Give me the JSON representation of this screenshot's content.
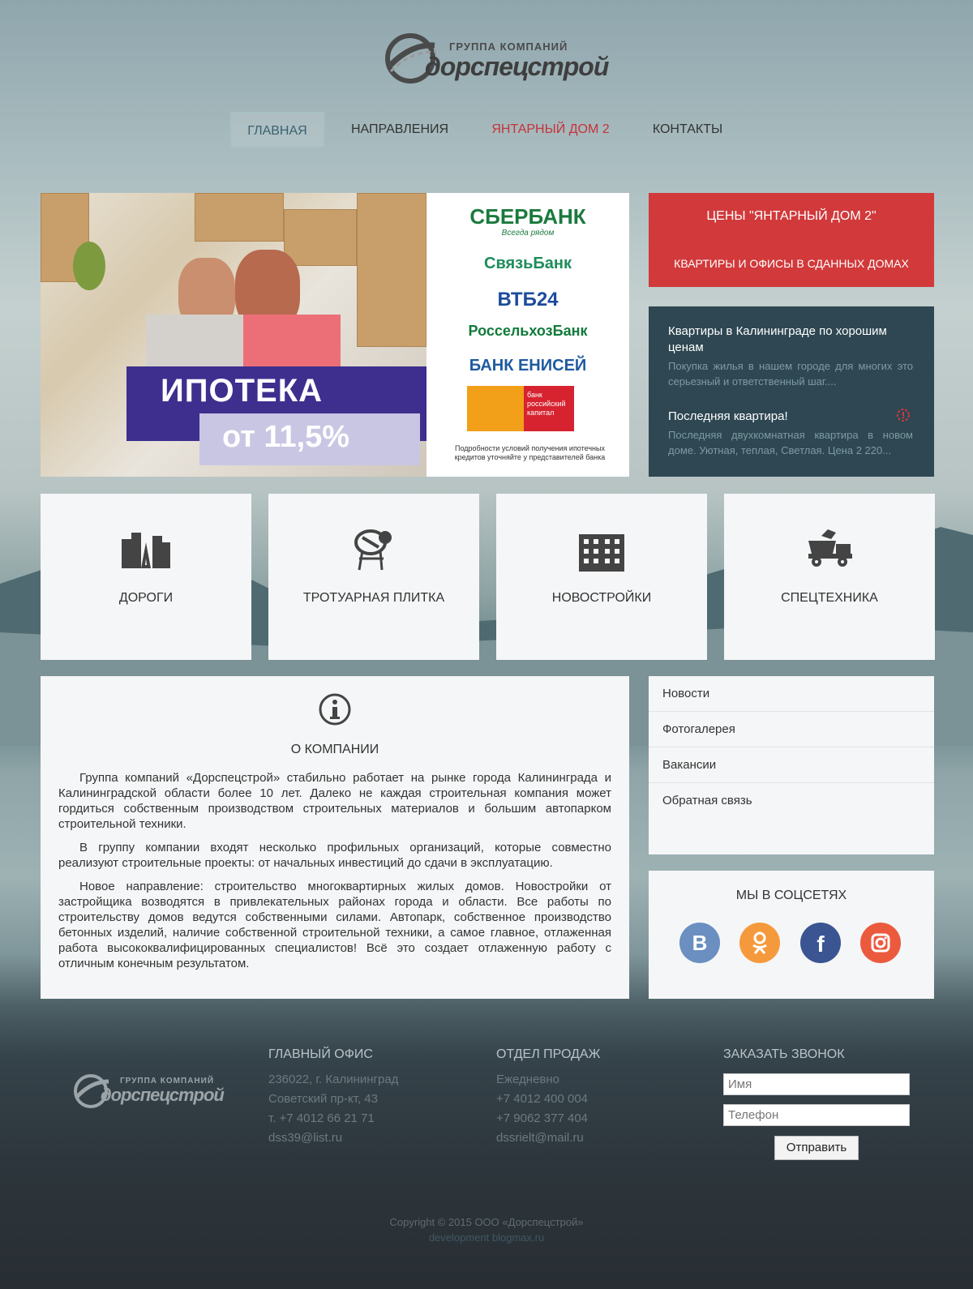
{
  "logo": {
    "tagline": "ГРУППА КОМПАНИЙ",
    "name": "дорспецстрой"
  },
  "nav": {
    "items": [
      "ГЛАВНАЯ",
      "НАПРАВЛЕНИЯ",
      "ЯНТАРНЫЙ ДОМ 2",
      "КОНТАКТЫ"
    ],
    "active": "ГЛАВНАЯ",
    "accent_color": "#c5333a"
  },
  "banner": {
    "title": "ИПОТЕКА",
    "rate": "от 11,5%",
    "banks": [
      "СБЕРБАНК",
      "Всегда рядом",
      "СвязьБанк",
      "ВТБ24",
      "РоссельхозБанк",
      "БАНК ЕНИСЕЙ",
      "банк российский капитал"
    ],
    "note": "Подробности условий получения ипотечных кредитов уточняйте у представителей банка"
  },
  "prices": {
    "title": "ЦЕНЫ \"ЯНТАРНЫЙ ДОМ 2\"",
    "subtitle": "КВАРТИРЫ И ОФИСЫ В СДАННЫХ ДОМАХ",
    "color": "#d1393b"
  },
  "news": [
    {
      "title": "Квартиры в Калининграде по хорошим ценам",
      "text": "Покупка жилья в нашем городе для многих это серьезный и ответственный шаг...."
    },
    {
      "title": "Последняя квартира!",
      "text": "Последняя двухкомнатная квартира в новом доме. Уютная, теплая, Светлая. Цена 2 220..."
    }
  ],
  "tiles": [
    {
      "label": "ДОРОГИ",
      "icon": "road-city-icon"
    },
    {
      "label": "ТРОТУАРНАЯ ПЛИТКА",
      "icon": "concrete-mixer-icon"
    },
    {
      "label": "НОВОСТРОЙКИ",
      "icon": "building-icon"
    },
    {
      "label": "СПЕЦТЕХНИКА",
      "icon": "dump-truck-icon"
    }
  ],
  "about": {
    "title": "О КОМПАНИИ",
    "paragraphs": [
      "Группа компаний «Дорспецстрой» стабильно работает на рынке города Калининграда и Калининградской области более 10 лет. Далеко не каждая строительная компания может гордиться собственным производством строительных материалов и большим автопарком строительной техники.",
      "В группу компании входят несколько профильных организаций, которые совместно реализуют строительные проекты: от начальных инвестиций до сдачи в эксплуатацию.",
      "Новое направление: строительство многоквартирных жилых домов. Новостройки от застройщика возводятся в привлекательных районах города и области. Все работы по строительству домов ведутся собственными силами. Автопарк, собственное производство бетонных изделий, наличие собственной строительной техники, а самое главное, отлаженная работа высококвалифицированных специалистов! Всё это создает отлаженную работу с отличным конечным результатом."
    ]
  },
  "sidemenu": [
    "Новости",
    "Фотогалерея",
    "Вакансии",
    "Обратная связь"
  ],
  "social": {
    "title": "МЫ В СОЦСЕТЯХ",
    "items": [
      {
        "name": "vk",
        "glyph": "В",
        "color": "#6a8fc0"
      },
      {
        "name": "odnoklassniki",
        "glyph": "ok",
        "color": "#f59a3c"
      },
      {
        "name": "facebook",
        "glyph": "f",
        "color": "#3a5592"
      },
      {
        "name": "instagram",
        "glyph": "ig",
        "color": "#ec5a3e"
      }
    ]
  },
  "footer": {
    "office": {
      "title": "ГЛАВНЫЙ ОФИС",
      "lines": [
        "236022, г. Калининград",
        "Советский пр-кт, 43",
        "т. +7 4012 66 21 71",
        "dss39@list.ru"
      ]
    },
    "sales": {
      "title": "ОТДЕЛ ПРОДАЖ",
      "lines": [
        "Ежедневно",
        "+7 4012 400 004",
        "+7 9062 377 404",
        "dssrielt@mail.ru"
      ]
    },
    "callback": {
      "title": "ЗАКАЗАТЬ ЗВОНОК",
      "name_placeholder": "Имя",
      "phone_placeholder": "Телефон",
      "send": "Отправить"
    },
    "copyright": "Copyright © 2015 ООО «Дорспецстрой»",
    "dev": "development blogmax.ru"
  }
}
